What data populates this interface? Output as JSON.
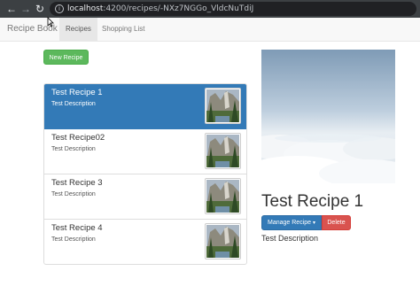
{
  "browser": {
    "url_host": "localhost",
    "url_path": ":4200/recipes/-NXz7NGGo_VldcNuTdiJ",
    "icons": [
      "back-arrow-icon",
      "forward-arrow-icon",
      "reload-icon",
      "info-icon"
    ]
  },
  "navbar": {
    "brand": "Recipe Book",
    "tabs": [
      {
        "label": "Recipes",
        "active": true
      },
      {
        "label": "Shopping List",
        "active": false
      }
    ]
  },
  "list": {
    "new_button": "New Recipe",
    "items": [
      {
        "name": "Test Recipe 1",
        "description": "Test Description",
        "active": true
      },
      {
        "name": "Test Recipe02",
        "description": "Test Description",
        "active": false
      },
      {
        "name": "Test Recipe 3",
        "description": "Test Description",
        "active": false
      },
      {
        "name": "Test Recipe 4",
        "description": "Test Description",
        "active": false
      }
    ]
  },
  "detail": {
    "title": "Test Recipe 1",
    "manage_button": "Manage Recipe",
    "manage_caret": "▾",
    "delete_button": "Delete",
    "description": "Test Description"
  },
  "colors": {
    "active": "#337ab7",
    "success": "#5cb85c",
    "danger": "#d9534f"
  }
}
